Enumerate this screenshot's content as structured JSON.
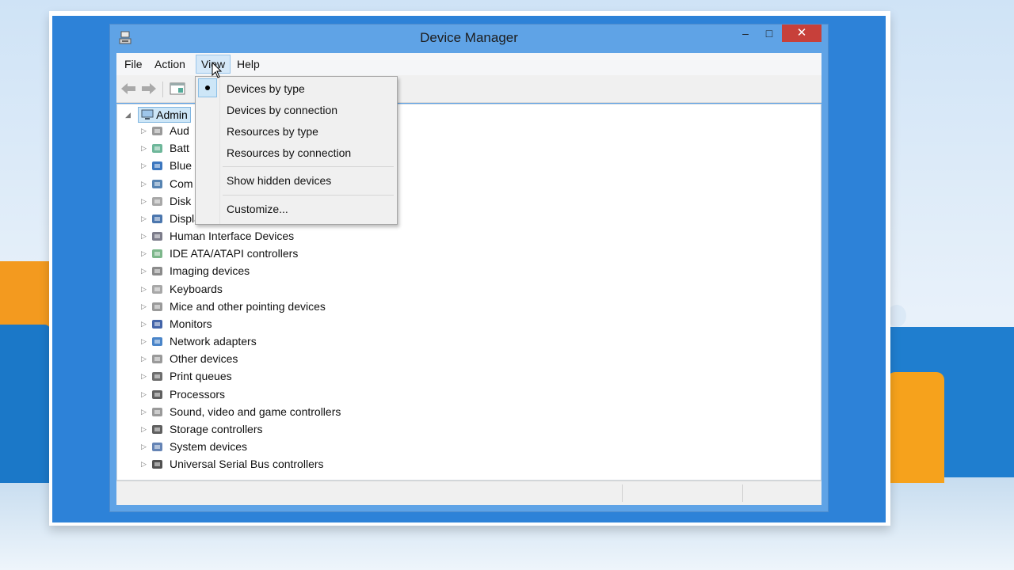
{
  "window": {
    "title": "Device Manager",
    "controls": {
      "minimize": "‒",
      "maximize": "□",
      "close": "✕"
    }
  },
  "menubar": {
    "items": [
      {
        "label": "File",
        "active": false
      },
      {
        "label": "Action",
        "active": false
      },
      {
        "label": "View",
        "active": true
      },
      {
        "label": "Help",
        "active": false
      }
    ]
  },
  "toolbar": {
    "buttons": [
      "back-arrow-icon",
      "forward-arrow-icon",
      "properties-icon"
    ]
  },
  "tree": {
    "root": "Admin",
    "categories": [
      {
        "label": "Aud",
        "icon": "speaker-icon"
      },
      {
        "label": "Batt",
        "icon": "battery-icon"
      },
      {
        "label": "Blue",
        "icon": "bluetooth-icon"
      },
      {
        "label": "Com",
        "icon": "computer-icon"
      },
      {
        "label": "Disk",
        "icon": "disk-drive-icon"
      },
      {
        "label": "Display adapters",
        "icon": "display-adapter-icon"
      },
      {
        "label": "Human Interface Devices",
        "icon": "hid-icon"
      },
      {
        "label": "IDE ATA/ATAPI controllers",
        "icon": "ide-controller-icon"
      },
      {
        "label": "Imaging devices",
        "icon": "camera-icon"
      },
      {
        "label": "Keyboards",
        "icon": "keyboard-icon"
      },
      {
        "label": "Mice and other pointing devices",
        "icon": "mouse-icon"
      },
      {
        "label": "Monitors",
        "icon": "monitor-icon"
      },
      {
        "label": "Network adapters",
        "icon": "network-icon"
      },
      {
        "label": "Other devices",
        "icon": "other-device-icon"
      },
      {
        "label": "Print queues",
        "icon": "printer-icon"
      },
      {
        "label": "Processors",
        "icon": "processor-icon"
      },
      {
        "label": "Sound, video and game controllers",
        "icon": "sound-icon"
      },
      {
        "label": "Storage controllers",
        "icon": "storage-icon"
      },
      {
        "label": "System devices",
        "icon": "system-icon"
      },
      {
        "label": "Universal Serial Bus controllers",
        "icon": "usb-icon"
      }
    ]
  },
  "view_menu": {
    "items": [
      {
        "label": "Devices by type",
        "checked": true
      },
      {
        "label": "Devices by connection",
        "checked": false
      },
      {
        "label": "Resources by type",
        "checked": false
      },
      {
        "label": "Resources by connection",
        "checked": false
      },
      {
        "label": "Show hidden devices",
        "checked": false
      },
      {
        "label": "Customize...",
        "checked": false
      }
    ]
  },
  "colors": {
    "title_bar": "#5fa3e6",
    "close_button": "#c7403a",
    "selection": "#cde6f7",
    "desktop": "#2d82d8"
  }
}
